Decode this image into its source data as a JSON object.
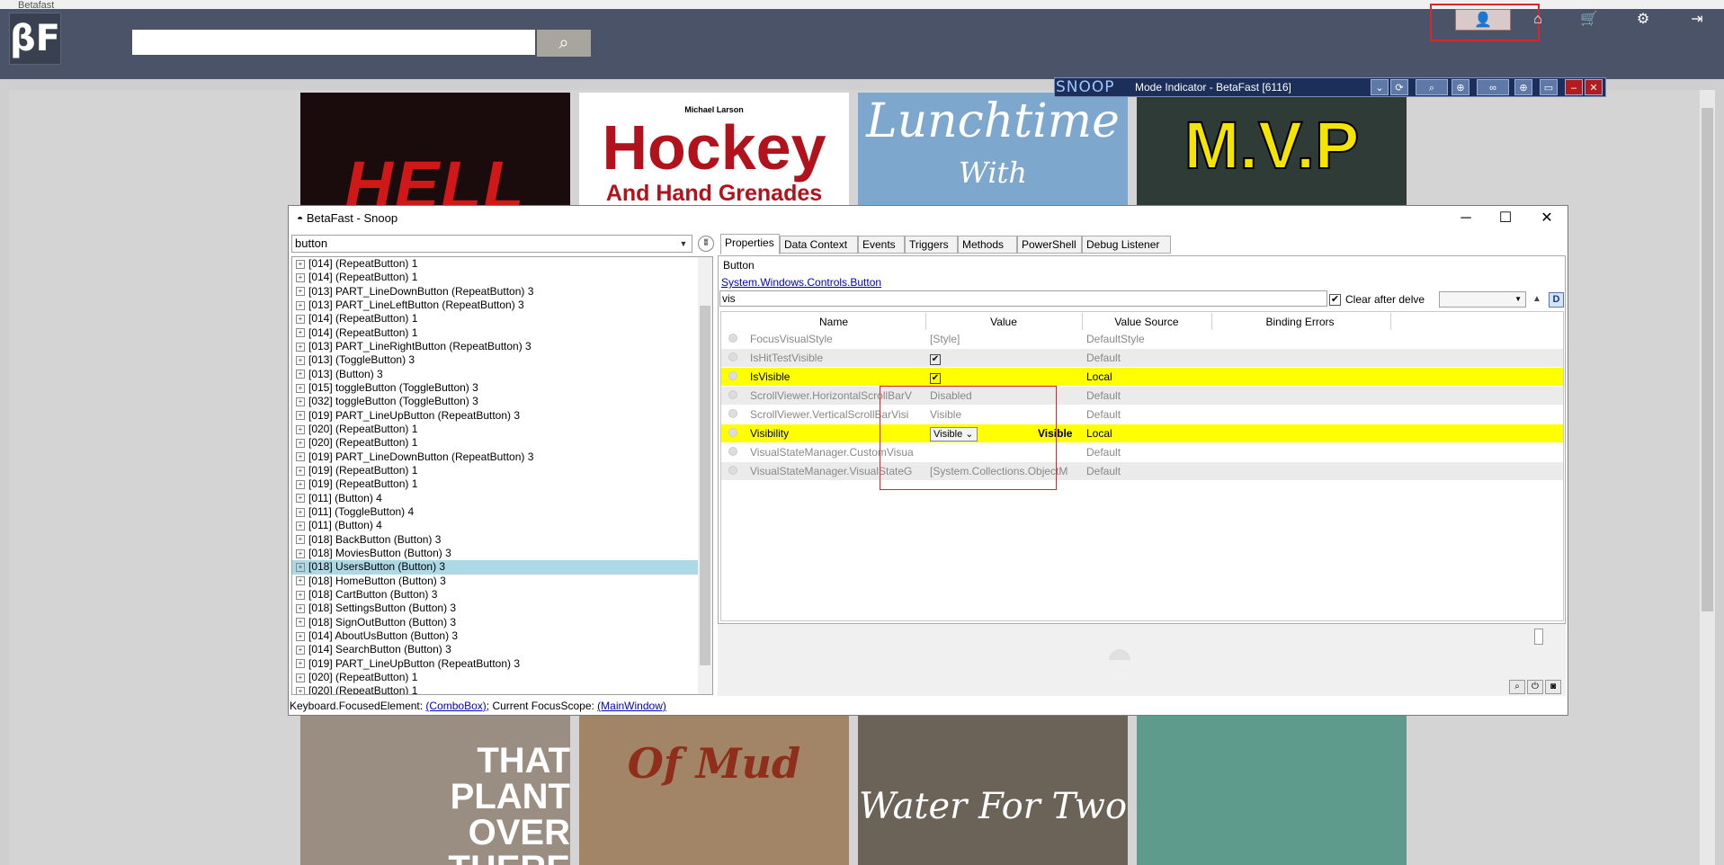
{
  "app": {
    "window_title": "Betafast",
    "logo_text": "βF",
    "search": {
      "value": "",
      "placeholder": ""
    },
    "nav": [
      {
        "name": "user",
        "icon": "👤"
      },
      {
        "name": "home",
        "icon": "⌂"
      },
      {
        "name": "cart",
        "icon": "🛒"
      },
      {
        "name": "settings",
        "icon": "⚙"
      },
      {
        "name": "signout",
        "icon": "⇥"
      }
    ]
  },
  "tiles": {
    "hell": "HELL",
    "hockey_author": "Michael Larson",
    "hockey_title": "Hockey",
    "hockey_sub": "And Hand Grenades",
    "lunch_title": "Lunchtime",
    "lunch_with": "With",
    "mvp": "M.V.P",
    "plant": "THAT PLANT OVER THERE",
    "mud": "Of Mud",
    "water": "Water For Two"
  },
  "snoop_bar": {
    "logo": "SNOOP",
    "title": "Mode Indicator - BetaFast [6116]"
  },
  "snoop_window": {
    "title": "BetaFast - Snoop",
    "filter": "button",
    "tree": [
      "[014]  (RepeatButton) 1",
      "[014]  (RepeatButton) 1",
      "[013] PART_LineDownButton (RepeatButton) 3",
      "[013] PART_LineLeftButton (RepeatButton) 3",
      "[014]  (RepeatButton) 1",
      "[014]  (RepeatButton) 1",
      "[013] PART_LineRightButton (RepeatButton) 3",
      "[013]  (ToggleButton) 3",
      "[013]  (Button) 3",
      "[015] toggleButton (ToggleButton) 3",
      "[032] toggleButton (ToggleButton) 3",
      "[019] PART_LineUpButton (RepeatButton) 3",
      "[020]  (RepeatButton) 1",
      "[020]  (RepeatButton) 1",
      "[019] PART_LineDownButton (RepeatButton) 3",
      "[019]  (RepeatButton) 1",
      "[019]  (RepeatButton) 1",
      "[011]  (Button) 4",
      "[011]  (ToggleButton) 4",
      "[011]  (Button) 4",
      "[018] BackButton (Button) 3",
      "[018] MoviesButton (Button) 3",
      "[018] UsersButton (Button) 3",
      "[018] HomeButton (Button) 3",
      "[018] CartButton (Button) 3",
      "[018] SettingsButton (Button) 3",
      "[018] SignOutButton (Button) 3",
      "[014] AboutUsButton (Button) 3",
      "[014] SearchButton (Button) 3",
      "[019] PART_LineUpButton (RepeatButton) 3",
      "[020]  (RepeatButton) 1",
      "[020]  (RepeatButton) 1"
    ],
    "selected_index": 22,
    "status": {
      "prefix": "Keyboard.FocusedElement: ",
      "focused": "(ComboBox)",
      "middle": "; Current FocusScope: ",
      "scope": "(MainWindow)"
    },
    "tabs": [
      "Properties",
      "Data Context",
      "Events",
      "Triggers",
      "Methods",
      "PowerShell",
      "Debug Listener"
    ],
    "object_name": "Button",
    "object_type": "System.Windows.Controls.Button",
    "prop_filter": "vis",
    "clear_after_delve": "Clear after delve",
    "d_button": "D",
    "grid_headers": [
      "Name",
      "Value",
      "Value Source",
      "Binding Errors"
    ],
    "rows": [
      {
        "name": "FocusVisualStyle",
        "value": "[Style]",
        "source": "DefaultStyle",
        "highlight": false
      },
      {
        "name": "IsHitTestVisible",
        "value": "✔",
        "source": "Default",
        "highlight": false
      },
      {
        "name": "IsVisible",
        "value": "✔",
        "source": "Local",
        "highlight": true
      },
      {
        "name": "ScrollViewer.HorizontalScrollBarV",
        "value": "Disabled",
        "source": "Default",
        "highlight": false
      },
      {
        "name": "ScrollViewer.VerticalScrollBarVisi",
        "value": "Visible",
        "source": "Default",
        "highlight": false
      },
      {
        "name": "Visibility",
        "value": "Visible",
        "value_bold": "Visible",
        "source": "Local",
        "highlight": true
      },
      {
        "name": "VisualStateManager.CustomVisua",
        "value": "",
        "source": "Default",
        "highlight": false
      },
      {
        "name": "VisualStateManager.VisualStateG",
        "value": "[System.Collections.ObjectM",
        "source": "Default",
        "highlight": false
      }
    ]
  },
  "colors": {
    "appbar": "#4a5368",
    "highlight_row": "#ffff00",
    "selected_tree": "#add8e6",
    "red_annotation": "#d6272e"
  }
}
